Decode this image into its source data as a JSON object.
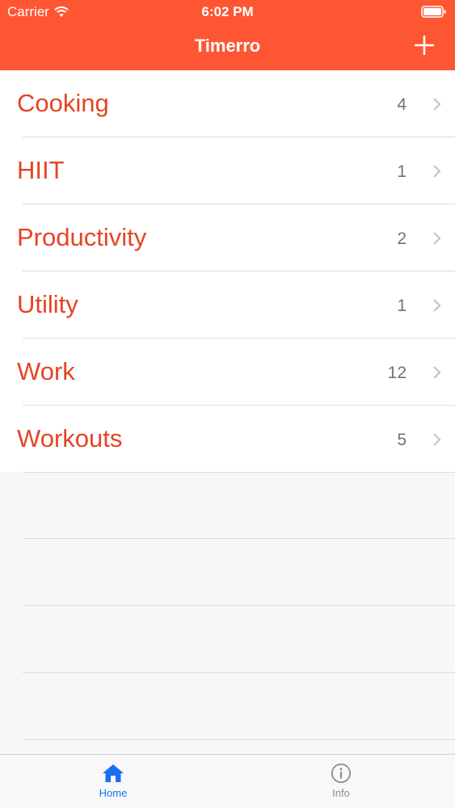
{
  "status_bar": {
    "carrier": "Carrier",
    "time": "6:02 PM"
  },
  "nav": {
    "title": "Timerro",
    "add_icon": "plus-icon"
  },
  "categories": [
    {
      "label": "Cooking",
      "count": "4"
    },
    {
      "label": "HIIT",
      "count": "1"
    },
    {
      "label": "Productivity",
      "count": "2"
    },
    {
      "label": "Utility",
      "count": "1"
    },
    {
      "label": "Work",
      "count": "12"
    },
    {
      "label": "Workouts",
      "count": "5"
    }
  ],
  "tabs": [
    {
      "label": "Home",
      "icon": "home-icon",
      "selected": true
    },
    {
      "label": "Info",
      "icon": "info-icon",
      "selected": false
    }
  ],
  "colors": {
    "accent": "#fe5633",
    "label": "#e34526",
    "tab_selected": "#1a6ff2",
    "tab_unselected": "#8e8e93"
  }
}
